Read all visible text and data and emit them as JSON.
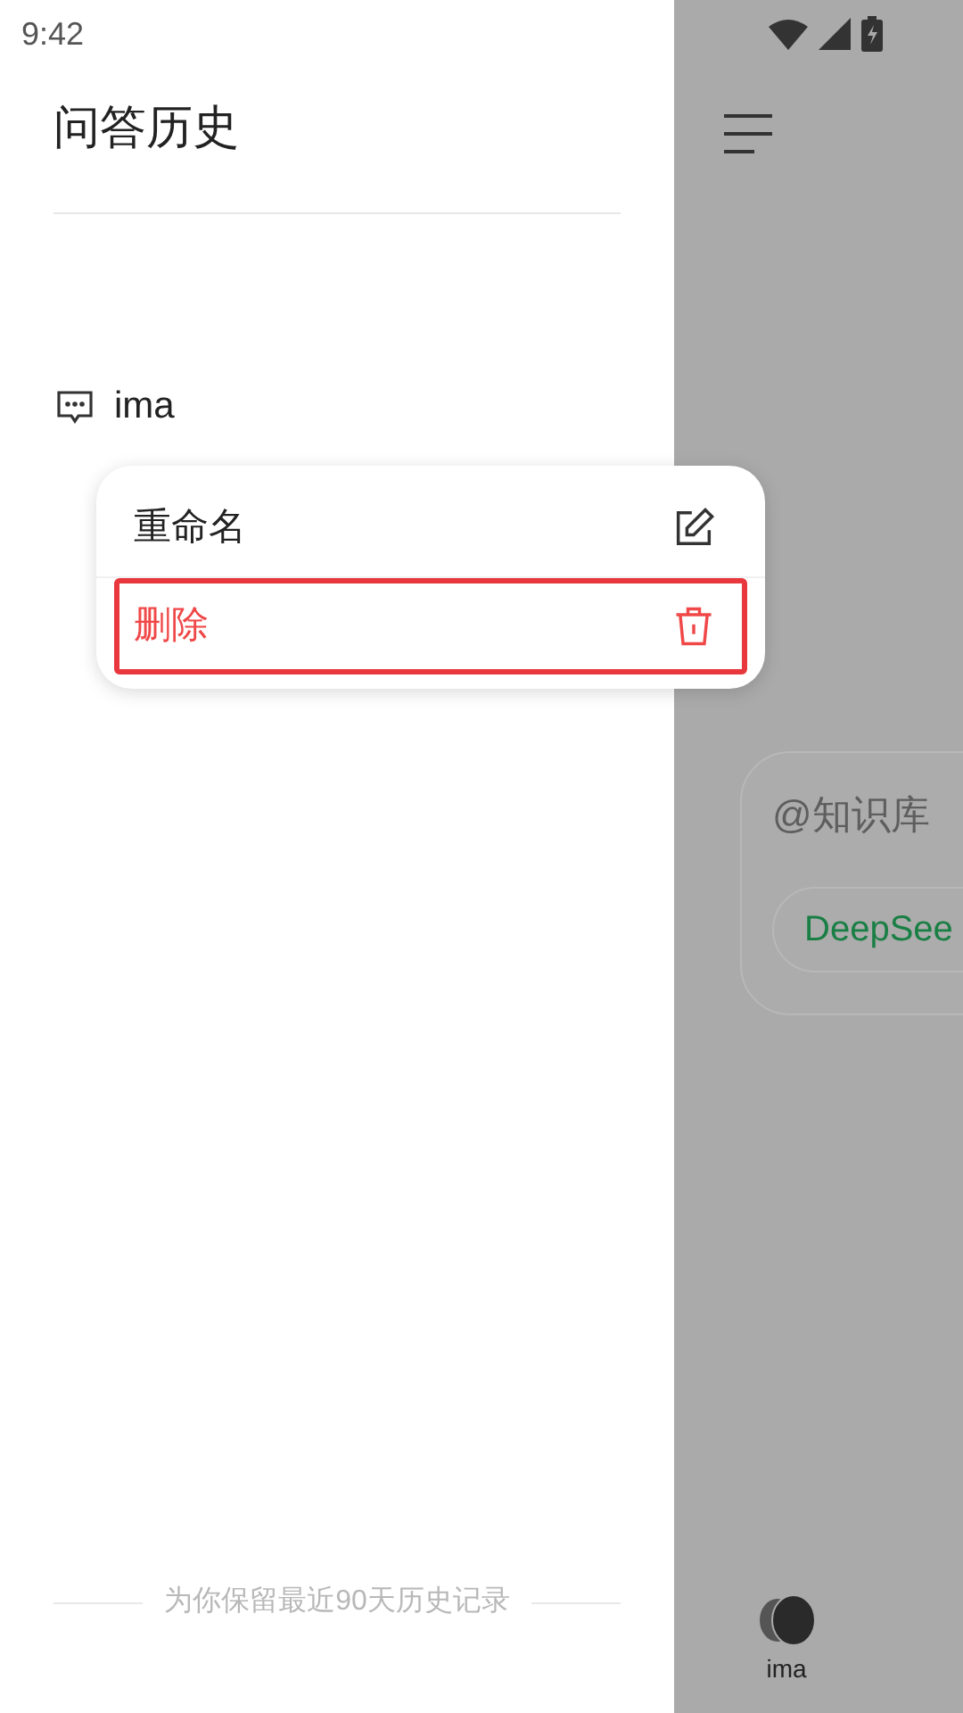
{
  "status_bar": {
    "time": "9:42"
  },
  "drawer": {
    "title": "问答历史",
    "conversations": [
      {
        "title": "ima"
      }
    ],
    "footer_note": "为你保留最近90天历史记录"
  },
  "context_menu": {
    "items": [
      {
        "label": "重命名",
        "kind": "rename",
        "highlighted": false
      },
      {
        "label": "删除",
        "kind": "delete",
        "highlighted": true
      }
    ]
  },
  "main": {
    "input_placeholder": "@知识库",
    "model_chip": "DeepSee",
    "bottom_nav": [
      {
        "label": "ima"
      }
    ]
  }
}
